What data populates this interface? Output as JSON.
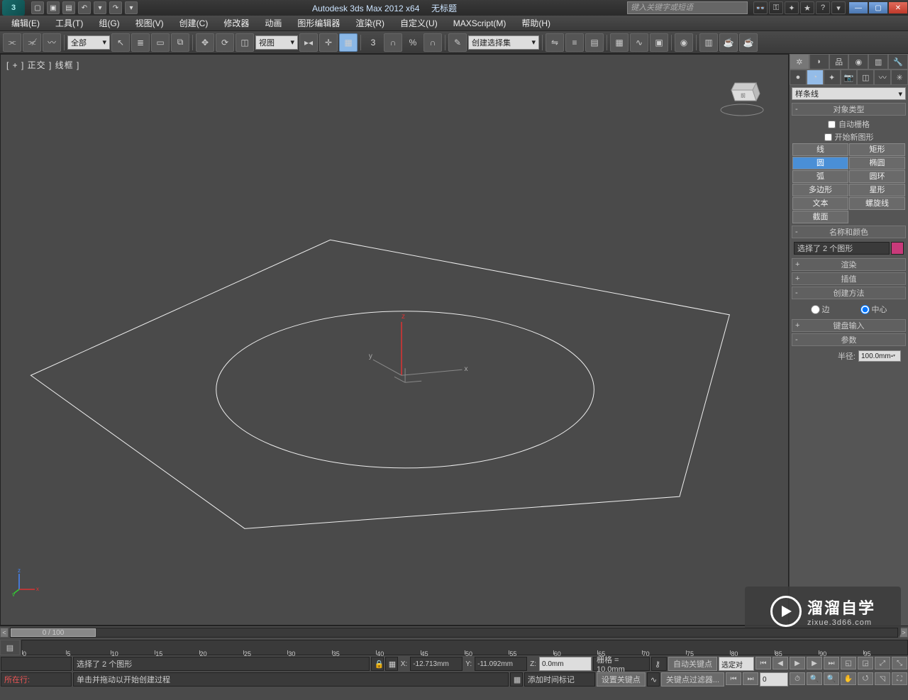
{
  "title": {
    "app": "Autodesk 3ds Max  2012 x64",
    "doc": "无标题",
    "search_placeholder": "键入关键字或短语"
  },
  "menu": {
    "edit": "编辑(E)",
    "tools": "工具(T)",
    "group": "组(G)",
    "views": "视图(V)",
    "create": "创建(C)",
    "modifiers": "修改器",
    "animation": "动画",
    "graph": "图形编辑器",
    "render": "渲染(R)",
    "customize": "自定义(U)",
    "maxscript": "MAXScript(M)",
    "help": "帮助(H)"
  },
  "toolbar": {
    "scope_dd": "全部",
    "view_dd": "视图",
    "three": "3",
    "percent": "%",
    "selset_dd": "创建选择集"
  },
  "viewport": {
    "label": "[ + ] 正交 ] 线框 ]",
    "axes": {
      "x": "x",
      "y": "y",
      "z": "z"
    }
  },
  "command": {
    "shape_dd": "样条线",
    "rollout_objtype": "对象类型",
    "autogrid": "自动栅格",
    "startnew": "开始新图形",
    "btns": {
      "line": "线",
      "rect": "矩形",
      "circle": "圆",
      "ellipse": "椭圆",
      "arc": "弧",
      "donut": "圆环",
      "ngon": "多边形",
      "star": "星形",
      "text": "文本",
      "helix": "螺旋线",
      "section": "截面"
    },
    "rollout_name": "名称和颜色",
    "name_value": "选择了 2 个图形",
    "rollout_render": "渲染",
    "rollout_interp": "插值",
    "rollout_method": "创建方法",
    "method_edge": "边",
    "method_center": "中心",
    "rollout_kbd": "键盘输入",
    "rollout_params": "参数",
    "radius_label": "半径:",
    "radius_value": "100.0mm"
  },
  "time": {
    "slider": "0 / 100",
    "ticks": [
      0,
      5,
      10,
      15,
      20,
      25,
      30,
      35,
      40,
      45,
      50,
      55,
      60,
      65,
      70,
      75,
      80,
      85,
      90,
      95
    ]
  },
  "status": {
    "sel": "选择了 2 个图形",
    "prompt": "单击并拖动以开始创建过程",
    "x_label": "X:",
    "x": "-12.713mm",
    "y_label": "Y:",
    "y": "-11.092mm",
    "z_label": "Z:",
    "z": "0.0mm",
    "grid": "栅格 = 10.0mm",
    "autokey": "自动关键点",
    "selobj": "选定对",
    "nowplaying": "所在行:",
    "setkey": "设置关键点",
    "keyfilter": "关键点过滤器...",
    "addtag": "添加时间标记",
    "frame": "0"
  },
  "watermark": {
    "main": "溜溜自学",
    "sub": "zixue.3d66.com"
  }
}
